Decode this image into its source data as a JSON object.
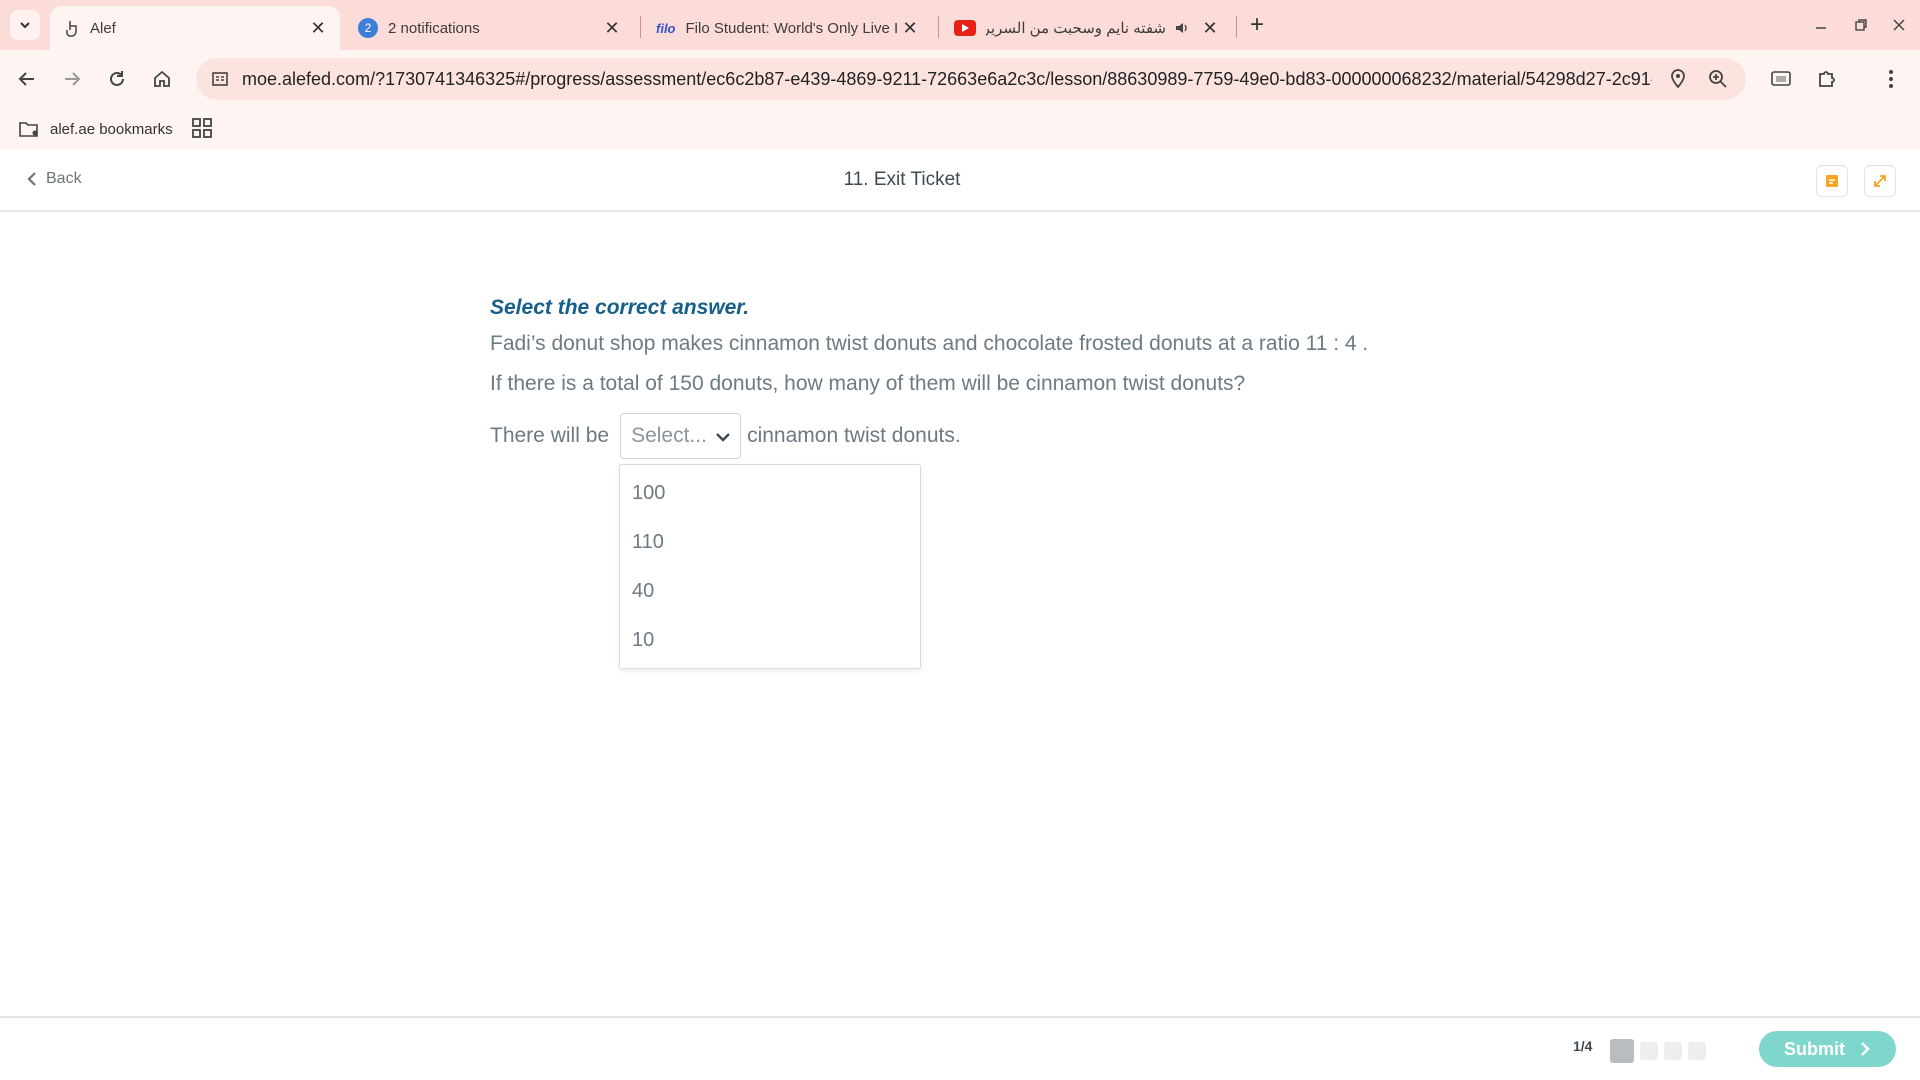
{
  "browser": {
    "tabs": [
      {
        "title": "Alef",
        "active": true
      },
      {
        "title": "2 notifications",
        "badge": "2"
      },
      {
        "title": "Filo Student: World's Only Live I",
        "logo": "filo"
      },
      {
        "title": "شفته نايم وسحبت من السرير",
        "icon": "youtube",
        "audio": true
      }
    ],
    "url": "moe.alefed.com/?1730741346325#/progress/assessment/ec6c2b87-e439-4869-9211-72663e6a2c3c/lesson/88630989-7759-49e0-bd83-000000068232/material/54298d27-2c91-...",
    "bookmarks": [
      {
        "label": "alef.ae bookmarks"
      }
    ]
  },
  "header": {
    "back_label": "Back",
    "title": "11. Exit Ticket"
  },
  "question": {
    "instruction": "Select the correct answer.",
    "text1": "Fadi’s donut shop makes cinnamon twist donuts and chocolate frosted donuts at a ratio 11 : 4 .",
    "text2": "If there is a total of 150 donuts, how many of them will be cinnamon twist donuts?",
    "answer_prefix": "There will be",
    "answer_suffix": "cinnamon twist donuts.",
    "select_placeholder": "Select...",
    "options": [
      "100",
      "110",
      "40",
      "10"
    ]
  },
  "footer": {
    "pager": "1/4",
    "submit_label": "Submit"
  },
  "colors": {
    "tabstrip": "#fcdcd8",
    "toolbar": "#fef5f3",
    "instruction": "#17608a",
    "submit": "#7fd6cd"
  }
}
